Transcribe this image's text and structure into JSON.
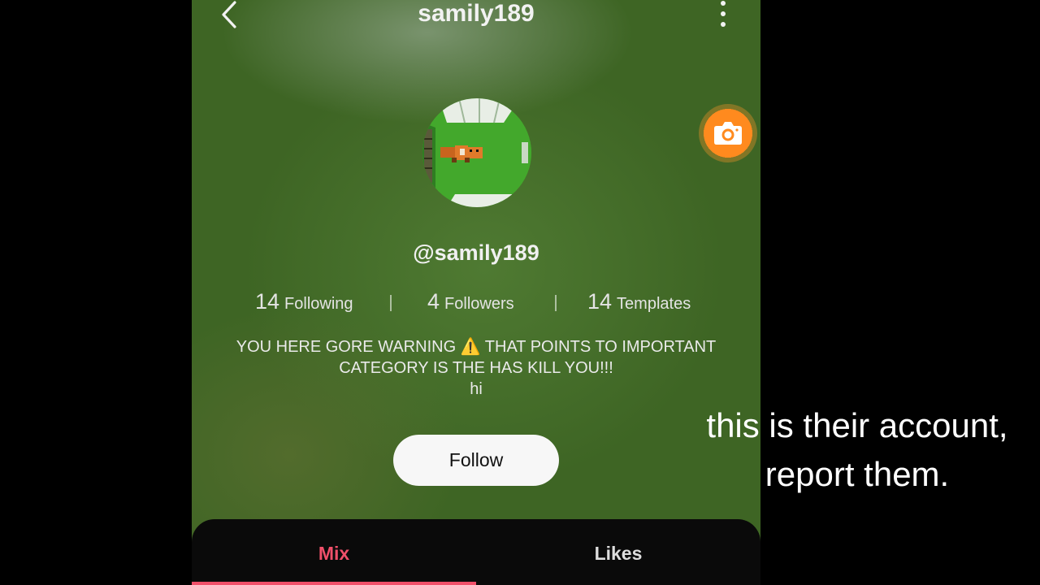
{
  "header": {
    "title": "samily189"
  },
  "profile": {
    "handle": "@samily189",
    "stats": [
      {
        "value": "14",
        "label": "Following"
      },
      {
        "value": "4",
        "label": "Followers"
      },
      {
        "value": "14",
        "label": "Templates"
      }
    ],
    "bio_line1": "YOU HERE GORE WARNING ⚠️ THAT POINTS TO IMPORTANT",
    "bio_line2": "CATEGORY IS THE HAS KILL YOU!!!",
    "bio_line3": "hi",
    "follow_label": "Follow"
  },
  "tabs": {
    "mix": "Mix",
    "likes": "Likes",
    "active": "Mix"
  },
  "caption": {
    "line1": "this is their account,",
    "line2": "report them."
  },
  "icons": {
    "back": "chevron-left-icon",
    "more": "more-vertical-icon",
    "camera": "camera-icon"
  },
  "colors": {
    "accent": "#f0506a",
    "camera_button": "#ff8a1e",
    "background_green": "#4f7a32"
  }
}
